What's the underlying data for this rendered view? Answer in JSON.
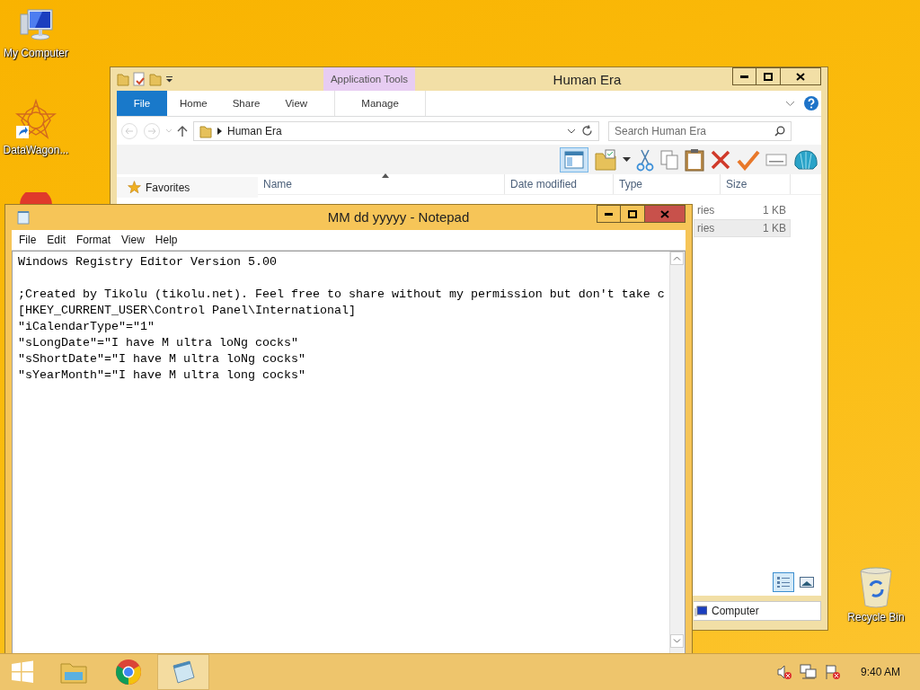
{
  "desktop_icons": [
    {
      "kind": "computer",
      "label": "My Computer"
    },
    {
      "kind": "shortcut",
      "label": "DataWagon..."
    },
    {
      "kind": "app"
    },
    {
      "kind": "recycle",
      "label": "Recycle Bin"
    }
  ],
  "explorer": {
    "title": "Human Era",
    "context_group": "Application Tools",
    "ribbon_tabs": [
      {
        "kind": "file",
        "label": "File"
      },
      {
        "kind": "tab",
        "label": "Home"
      },
      {
        "kind": "tab",
        "label": "Share"
      },
      {
        "kind": "tab",
        "label": "View"
      },
      {
        "kind": "contextual",
        "label": "Manage"
      }
    ],
    "address": "Human Era",
    "search": {
      "placeholder": "Search Human Era"
    },
    "preview_pane": true,
    "favorites": "Favorites",
    "computer": "Computer",
    "columns": [
      "Name",
      "Date modified",
      "Type",
      "Size"
    ],
    "rows": [
      {
        "type": "ries",
        "size": "1 KB",
        "selected": false
      },
      {
        "type": "ries",
        "size": "1 KB",
        "selected": true
      }
    ],
    "view_buttons": [
      {
        "kind": "details",
        "selected": true
      },
      {
        "kind": "thumbnails",
        "selected": false
      }
    ]
  },
  "notepad": {
    "title": "MM dd yyyyy - Notepad",
    "menu": [
      "File",
      "Edit",
      "Format",
      "View",
      "Help"
    ],
    "text": "Windows Registry Editor Version 5.00\n\n;Created by Tikolu (tikolu.net). Feel free to share without my permission but don't take c\n[HKEY_CURRENT_USER\\Control Panel\\International]\n\"iCalendarType\"=\"1\"\n\"sLongDate\"=\"I have M ultra loNg cocks\"\n\"sShortDate\"=\"I have M ultra loNg cocks\"\n\"sYearMonth\"=\"I have M ultra long cocks\""
  },
  "taskbar": {
    "apps": [
      {
        "kind": "explorer",
        "selected": false
      },
      {
        "kind": "chrome",
        "selected": false
      },
      {
        "kind": "notepad",
        "selected": true
      }
    ],
    "clock": "9:40 AM"
  }
}
